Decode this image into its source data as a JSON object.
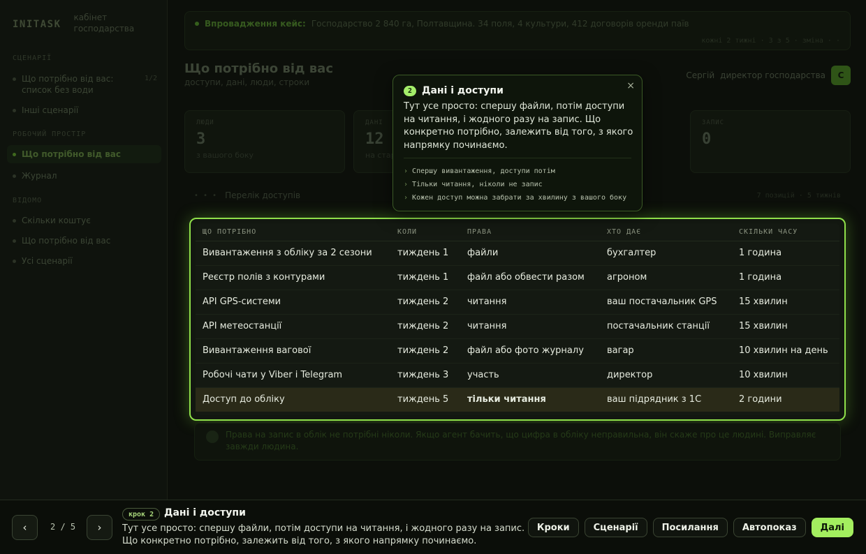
{
  "sidebar": {
    "logo": "INITASK",
    "subtitle": "кабінет господарства",
    "sections": [
      {
        "label": "СЦЕНАРІЇ"
      },
      {
        "label": "РОБОЧИЙ ПРОСТІР"
      },
      {
        "label": "ВІДОМО"
      }
    ],
    "items": [
      {
        "label": "Що потрібно від вас: список без води",
        "badge": "1/2"
      },
      {
        "label": "Інші сценарії"
      },
      {
        "label": "Що потрібно від вас"
      },
      {
        "label": "Журнал"
      },
      {
        "label": "Скільки коштує"
      },
      {
        "label": "Що потрібно від вас"
      },
      {
        "label": "Усі сценарії"
      }
    ]
  },
  "banner": {
    "label": "Впровадження кейс:",
    "text": "Господарство 2 840 га, Полтавщина. 34 поля, 4 культури, 412 договорів оренди паїв",
    "meta": "кожні 2 тижні · 3 з 5 · зміна · ·"
  },
  "page": {
    "title": "Що потрібно від вас",
    "subtitle": "доступи, дані, люди, строки"
  },
  "user": {
    "name": "Сергій",
    "role": "директор господарства",
    "avatar": "С"
  },
  "stats": [
    {
      "label": "ЛЮДИ",
      "value": "3",
      "note": "з вашого боку"
    },
    {
      "label": "ДАНІ",
      "value": "12",
      "note": "на старт"
    },
    {
      "label": "ЗАПИС",
      "value": "0",
      "note": ""
    }
  ],
  "subhead": {
    "dots": "• • •",
    "title": "Перелік доступів",
    "right": "7 позицій · 5 тижнів"
  },
  "table": {
    "columns": [
      "ЩО ПОТРІБНО",
      "КОЛИ",
      "ПРАВА",
      "ХТО ДАЄ",
      "СКІЛЬКИ ЧАСУ"
    ],
    "rows": [
      [
        "Вивантаження з обліку за 2 сезони",
        "тиждень 1",
        "файли",
        "бухгалтер",
        "1 година"
      ],
      [
        "Реєстр полів з контурами",
        "тиждень 1",
        "файл або обвести разом",
        "агроном",
        "1 година"
      ],
      [
        "API GPS-системи",
        "тиждень 2",
        "читання",
        "ваш постачальник GPS",
        "15 хвилин"
      ],
      [
        "API метеостанції",
        "тиждень 2",
        "читання",
        "постачальник станції",
        "15 хвилин"
      ],
      [
        "Вивантаження вагової",
        "тиждень 2",
        "файл або фото журналу",
        "вагар",
        "10 хвилин на день"
      ],
      [
        "Робочі чати у Viber і Telegram",
        "тиждень 3",
        "участь",
        "директор",
        "10 хвилин"
      ],
      [
        "Доступ до обліку",
        "тиждень 5",
        "тільки читання",
        "ваш підрядник з 1С",
        "2 години"
      ]
    ]
  },
  "note": {
    "text": "Права на запис в облік не потрібні ніколи. Якщо агент бачить, що цифра в обліку неправильна, він скаже про це людині. Виправляє завжди людина."
  },
  "popover": {
    "step": "2",
    "title": "Дані і доступи",
    "body": "Тут усе просто: спершу файли, потім доступи на читання, і жодного разу на запис. Що конкретно потрібно, залежить від того, з якого напрямку починаємо.",
    "bullets": [
      "Спершу вивантаження, доступи потім",
      "Тільки читання, ніколи не запис",
      "Кожен доступ можна забрати за хвилину з вашого боку"
    ],
    "close": "×"
  },
  "bottombar": {
    "prev": "‹",
    "next": "›",
    "counter": "2 / 5",
    "step_label": "крок 2",
    "step_title": "Дані і доступи",
    "step_desc": "Тут усе просто: спершу файли, потім доступи на читання, і жодного разу на запис. Що конкретно потрібно, залежить від того, з якого напрямку починаємо.",
    "buttons": [
      "Кроки",
      "Сценарії",
      "Посилання",
      "Автопоказ",
      "Далі"
    ]
  }
}
